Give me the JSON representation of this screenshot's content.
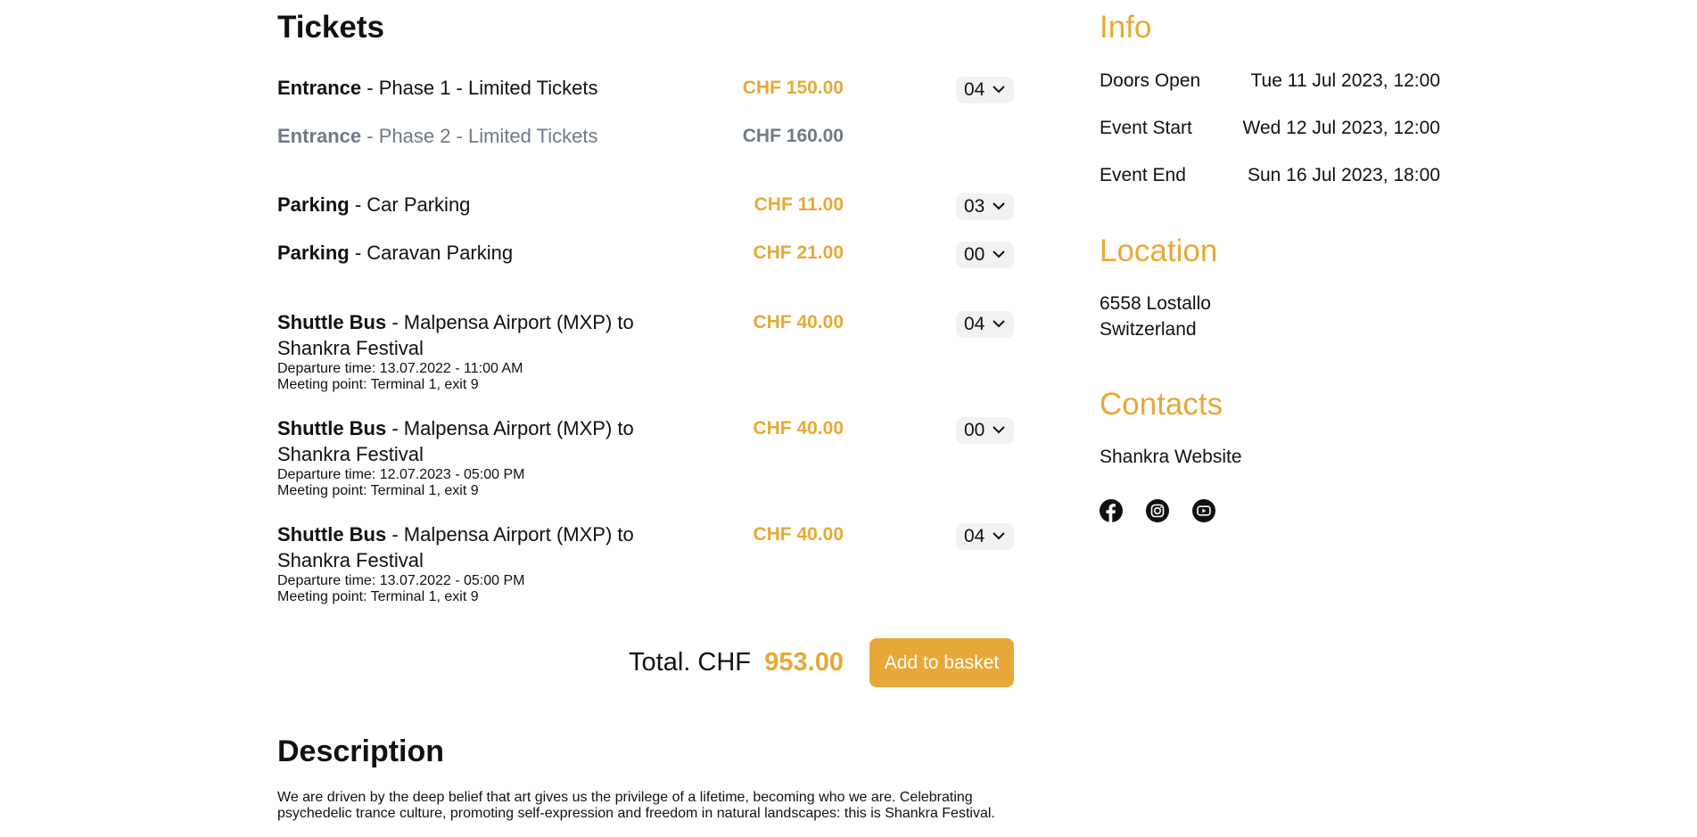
{
  "tickets": {
    "heading": "Tickets",
    "items": [
      {
        "category": "Entrance",
        "name": " - Phase 1 - Limited Tickets",
        "price": "CHF 150.00",
        "qty": "04",
        "details": []
      },
      {
        "category": "Entrance",
        "name": " - Phase 2 - Limited Tickets",
        "price": "CHF 160.00",
        "qty": "",
        "details": []
      },
      {
        "category": "Parking",
        "name": " - Car Parking",
        "price": "CHF 11.00",
        "qty": "03",
        "details": []
      },
      {
        "category": "Parking",
        "name": " - Caravan Parking",
        "price": "CHF 21.00",
        "qty": "00",
        "details": []
      },
      {
        "category": "Shuttle Bus",
        "name": " - Malpensa Airport (MXP) to Shankra Festival",
        "price": "CHF 40.00",
        "qty": "04",
        "details": [
          "Departure time: 13.07.2022 - 11:00 AM",
          "Meeting point: Terminal 1, exit 9"
        ]
      },
      {
        "category": "Shuttle Bus",
        "name": " - Malpensa Airport (MXP) to Shankra Festival",
        "price": "CHF 40.00",
        "qty": "00",
        "details": [
          "Departure time: 12.07.2023 - 05:00 PM",
          "Meeting point: Terminal 1, exit 9"
        ]
      },
      {
        "category": "Shuttle Bus",
        "name": " - Malpensa Airport (MXP) to Shankra Festival",
        "price": "CHF 40.00",
        "qty": "04",
        "details": [
          "Departure time: 13.07.2022 - 05:00 PM",
          "Meeting point: Terminal 1, exit 9"
        ]
      }
    ],
    "total_label": "Total. CHF",
    "total_amount": "953.00",
    "add_button": "Add to basket"
  },
  "description": {
    "heading": "Description",
    "text": "We are driven by the deep belief that art gives us the privilege of a lifetime, becoming who we are. Celebrating psychedelic trance culture, promoting self-expression and freedom in natural landscapes: this is Shankra Festival."
  },
  "info": {
    "heading": "Info",
    "rows": [
      {
        "label": "Doors Open",
        "value": "Tue 11 Jul 2023, 12:00"
      },
      {
        "label": "Event Start",
        "value": "Wed 12 Jul 2023, 12:00"
      },
      {
        "label": "Event End",
        "value": "Sun 16 Jul 2023, 18:00"
      }
    ]
  },
  "location": {
    "heading": "Location",
    "line1": "6558 Lostallo",
    "line2": "Switzerland"
  },
  "contacts": {
    "heading": "Contacts",
    "website": "Shankra Website",
    "social_icons": [
      "facebook-icon",
      "instagram-icon",
      "youtube-icon"
    ]
  },
  "colors": {
    "accent": "#e8a838",
    "text": "#111111",
    "disabled_text": "#707a85",
    "qty_background": "#f1f2f3"
  }
}
